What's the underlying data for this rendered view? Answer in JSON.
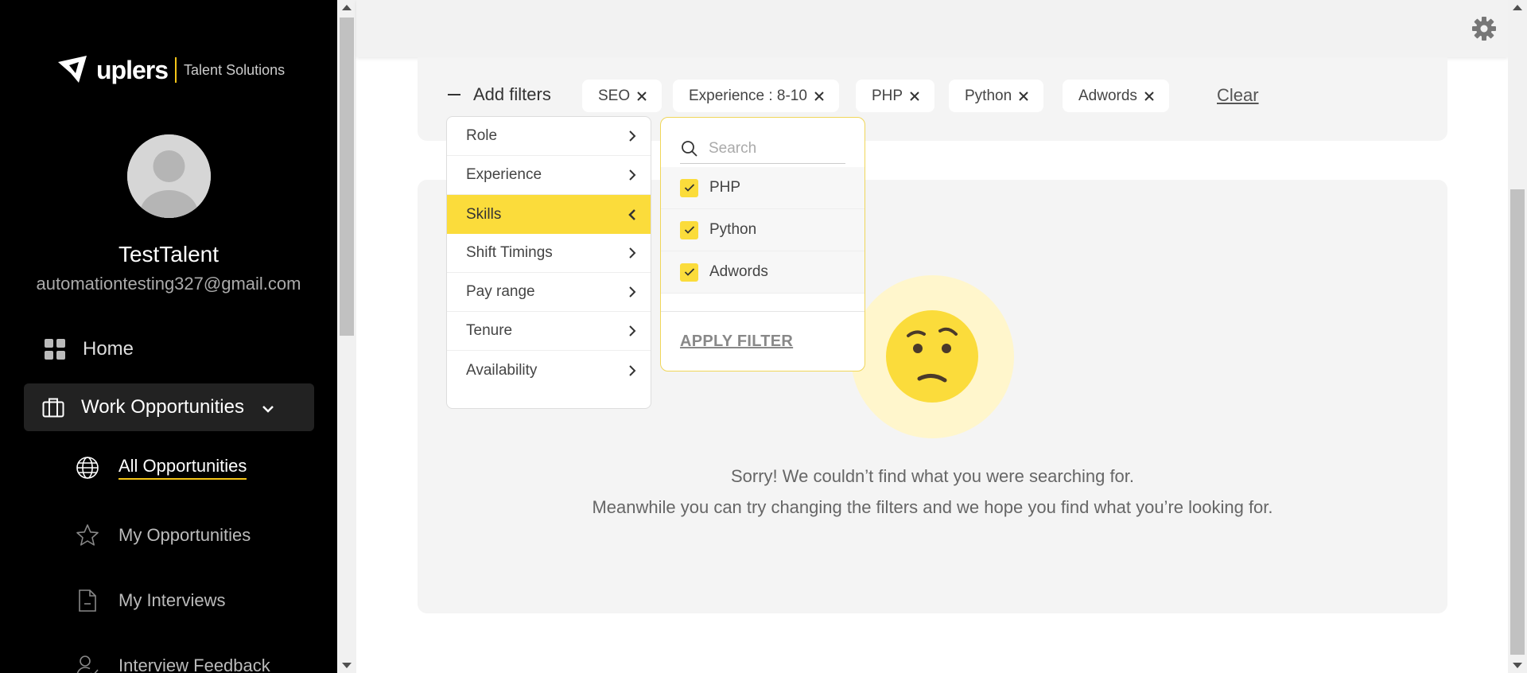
{
  "brand": {
    "name": "uplers",
    "tagline": "Talent Solutions",
    "accent": "#f5c518"
  },
  "user": {
    "name": "TestTalent",
    "email": "automationtesting327@gmail.com"
  },
  "nav": {
    "home": "Home",
    "work": "Work Opportunities",
    "sub": [
      {
        "label": "All Opportunities",
        "icon": "globe-icon",
        "active": true
      },
      {
        "label": "My Opportunities",
        "icon": "star-icon"
      },
      {
        "label": "My Interviews",
        "icon": "document-icon"
      },
      {
        "label": "Interview Feedback",
        "icon": "user-check-icon"
      }
    ]
  },
  "filters": {
    "add_label": "Add filters",
    "chips": [
      "SEO",
      "Experience : 8-10",
      "PHP",
      "Python",
      "Adwords"
    ],
    "clear_label": "Clear",
    "categories": [
      "Role",
      "Experience",
      "Skills",
      "Shift Timings",
      "Pay range",
      "Tenure",
      "Availability"
    ],
    "active_category": "Skills",
    "search_placeholder": "Search",
    "skills": [
      {
        "label": "PHP",
        "checked": true
      },
      {
        "label": "Python",
        "checked": true
      },
      {
        "label": "Adwords",
        "checked": true
      }
    ],
    "apply_label": "APPLY FILTER"
  },
  "empty_state": {
    "line1": "Sorry! We couldn’t find what you were searching for.",
    "line2": "Meanwhile you can try changing the filters and we hope you find what you’re looking for."
  }
}
